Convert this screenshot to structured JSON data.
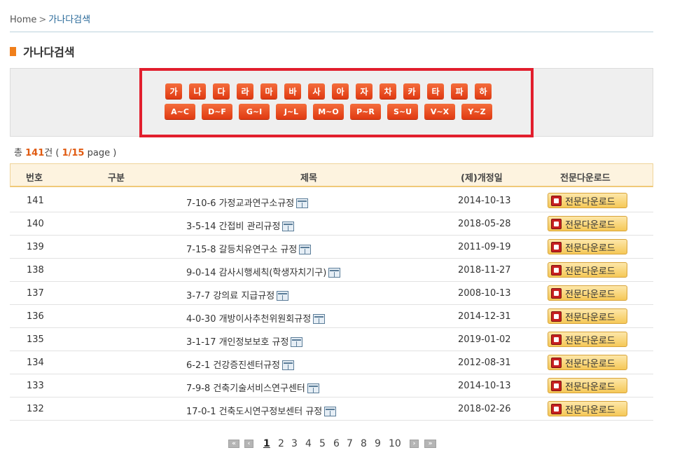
{
  "breadcrumb": {
    "home": "Home",
    "separator": ">",
    "current": "가나다검색"
  },
  "page_title": "가나다검색",
  "korean_buttons": [
    "가",
    "나",
    "다",
    "라",
    "마",
    "바",
    "사",
    "아",
    "자",
    "차",
    "카",
    "타",
    "파",
    "하"
  ],
  "english_buttons": [
    "A~C",
    "D~F",
    "G~I",
    "J~L",
    "M~O",
    "P~R",
    "S~U",
    "V~X",
    "Y~Z"
  ],
  "summary": {
    "prefix": "총",
    "total": "141",
    "unit": "건",
    "open": "(",
    "page": "1/15",
    "page_label": "page",
    "close": ")"
  },
  "table": {
    "headers": [
      "번호",
      "구분",
      "제목",
      "(제)개정일",
      "전문다운로드"
    ],
    "rows": [
      {
        "no": "141",
        "category": "",
        "title": "7-10-6  가정교과연구소규정",
        "date": "2014-10-13",
        "download": "전문다운로드"
      },
      {
        "no": "140",
        "category": "",
        "title": "3-5-14  간접비 관리규정",
        "date": "2018-05-28",
        "download": "전문다운로드"
      },
      {
        "no": "139",
        "category": "",
        "title": "7-15-8  갈등치유연구소 규정",
        "date": "2011-09-19",
        "download": "전문다운로드"
      },
      {
        "no": "138",
        "category": "",
        "title": "9-0-14  감사시행세칙(학생자치기구)",
        "date": "2018-11-27",
        "download": "전문다운로드"
      },
      {
        "no": "137",
        "category": "",
        "title": "3-7-7  강의료 지급규정",
        "date": "2008-10-13",
        "download": "전문다운로드"
      },
      {
        "no": "136",
        "category": "",
        "title": "4-0-30  개방이사추천위원회규정",
        "date": "2014-12-31",
        "download": "전문다운로드"
      },
      {
        "no": "135",
        "category": "",
        "title": "3-1-17  개인정보보호 규정",
        "date": "2019-01-02",
        "download": "전문다운로드"
      },
      {
        "no": "134",
        "category": "",
        "title": "6-2-1  건강증진센터규정",
        "date": "2012-08-31",
        "download": "전문다운로드"
      },
      {
        "no": "133",
        "category": "",
        "title": "7-9-8  건축기술서비스연구센터",
        "date": "2014-10-13",
        "download": "전문다운로드"
      },
      {
        "no": "132",
        "category": "",
        "title": "17-0-1  건축도시연구정보센터 규정",
        "date": "2018-02-26",
        "download": "전문다운로드"
      }
    ]
  },
  "pagination": {
    "first": "«",
    "prev": "‹",
    "pages": [
      "1",
      "2",
      "3",
      "4",
      "5",
      "6",
      "7",
      "8",
      "9",
      "10"
    ],
    "current": "1",
    "next": "›",
    "last": "»"
  }
}
